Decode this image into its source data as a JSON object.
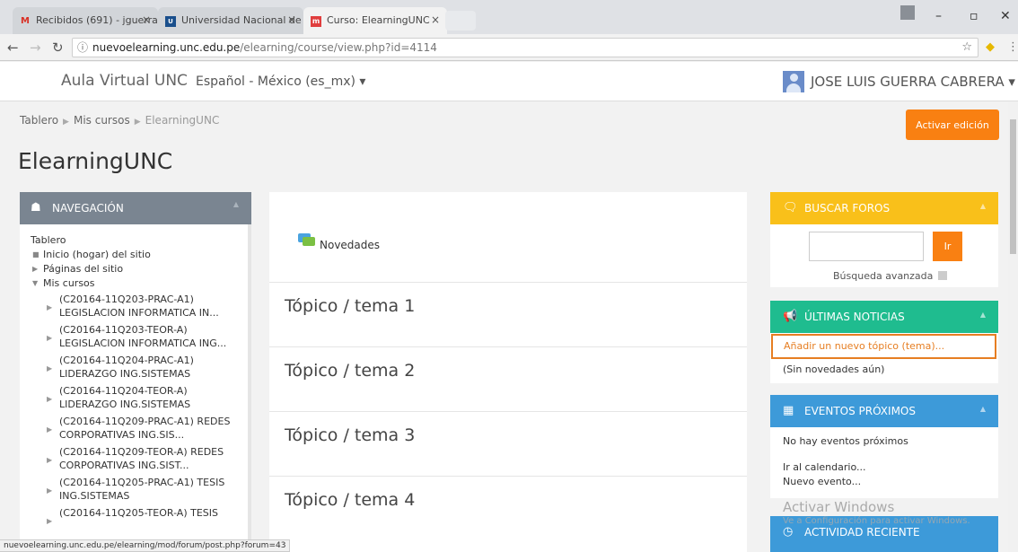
{
  "browser": {
    "tabs": [
      {
        "title": "Recibidos (691) - jguerra",
        "icon": "gmail-icon"
      },
      {
        "title": "Universidad Nacional de",
        "icon": "unc-icon"
      },
      {
        "title": "Curso: ElearningUNC",
        "icon": "moodle-icon"
      }
    ],
    "url_host": "nuevoelearning.unc.edu.pe",
    "url_path": "/elearning/course/view.php?id=4114"
  },
  "header": {
    "brand": "Aula Virtual UNC",
    "language": "Español - México (es_mx) ▾",
    "user": "JOSE LUIS GUERRA CABRERA ▾"
  },
  "breadcrumb": {
    "home": "Tablero",
    "courses": "Mis cursos",
    "current": "ElearningUNC"
  },
  "edit_button": "Activar edición",
  "page_title": "ElearningUNC",
  "navigation": {
    "title": "NAVEGACIÓN",
    "root": "Tablero",
    "items": [
      "Inicio (hogar) del sitio",
      "Páginas del sitio",
      "Mis cursos"
    ],
    "courses": [
      [
        "(C20164-11Q203-PRAC-A1)",
        "LEGISLACION INFORMATICA IN..."
      ],
      [
        "(C20164-11Q203-TEOR-A)",
        "LEGISLACION INFORMATICA ING..."
      ],
      [
        "(C20164-11Q204-PRAC-A1)",
        "LIDERAZGO ING.SISTEMAS"
      ],
      [
        "(C20164-11Q204-TEOR-A)",
        "LIDERAZGO ING.SISTEMAS"
      ],
      [
        "(C20164-11Q209-PRAC-A1) REDES",
        "CORPORATIVAS ING.SIS..."
      ],
      [
        "(C20164-11Q209-TEOR-A) REDES",
        "CORPORATIVAS ING.SIST..."
      ],
      [
        "(C20164-11Q205-PRAC-A1) TESIS",
        "ING.SISTEMAS"
      ],
      [
        "(C20164-11Q205-TEOR-A) TESIS",
        ""
      ]
    ]
  },
  "center": {
    "forum": "Novedades",
    "topics": [
      "Tópico / tema 1",
      "Tópico / tema 2",
      "Tópico / tema 3",
      "Tópico / tema 4"
    ]
  },
  "search_forums": {
    "title": "BUSCAR FOROS",
    "go": "Ir",
    "advanced": "Búsqueda avanzada",
    "color": "#f9c01a"
  },
  "latest_news": {
    "title": "ÚLTIMAS NOTICIAS",
    "add_topic": "Añadir un nuevo tópico (tema)...",
    "none": "(Sin novedades aún)",
    "color": "#1fbc8f"
  },
  "upcoming_events": {
    "title": "EVENTOS PRÓXIMOS",
    "none": "No hay eventos próximos",
    "calendar": "Ir al calendario...",
    "new_event": "Nuevo evento...",
    "color": "#3d9ad9"
  },
  "recent_activity": {
    "title": "ACTIVIDAD RECIENTE",
    "color": "#3d9ad9"
  },
  "windows_overlay": {
    "line1": "Activar Windows",
    "line2": "Ve a Configuración para activar Windows."
  },
  "status_url": "nuevoelearning.unc.edu.pe/elearning/mod/forum/post.php?forum=43"
}
